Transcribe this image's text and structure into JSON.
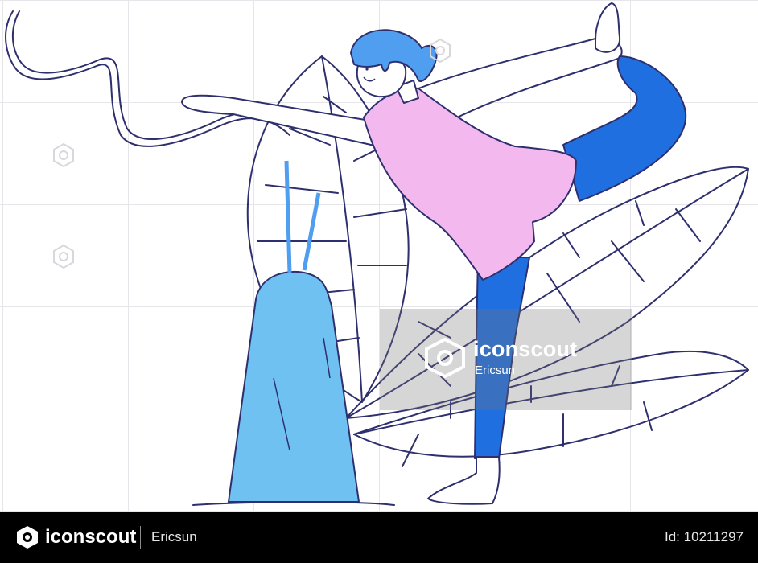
{
  "watermark": {
    "brand": "iconscout",
    "author": "Ericsun"
  },
  "footer": {
    "brand": "iconscout",
    "author": "Ericsun",
    "id_text": "Id: 10211297"
  },
  "colors": {
    "outline": "#2e2f6e",
    "hair": "#4f9ef0",
    "top": "#f3b9ef",
    "leggings": "#1f6fe0",
    "skin": "#ffffff",
    "mountain": "#6ec1f1",
    "footer_bg": "#000000"
  },
  "icons": [
    "iconscout-logo-icon",
    "watermark-icon"
  ]
}
